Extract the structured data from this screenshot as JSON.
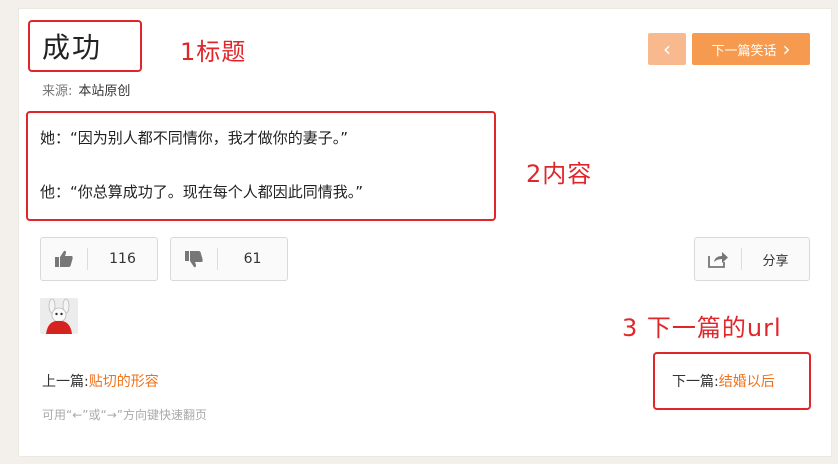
{
  "article": {
    "title": "成功",
    "source_label": "来源:",
    "source_value": "本站原创",
    "lines": [
      "她：“因为别人都不同情你，我才做你的妻子。”",
      "他：“你总算成功了。现在每个人都因此同情我。”"
    ]
  },
  "nav": {
    "prev_symbol": "‹",
    "next_label": "下一篇笑话",
    "next_symbol": "›"
  },
  "votes": {
    "up_count": "116",
    "down_count": "61",
    "share_label": "分享"
  },
  "footer": {
    "prev_label": "上一篇:",
    "prev_title": "贴切的形容",
    "next_label": "下一篇:",
    "next_title": "结婚以后",
    "hint": "可用“←”或“→”方向键快速翻页"
  },
  "annotations": {
    "a1": "1标题",
    "a2": "2内容",
    "a3": "3 下一篇的url"
  },
  "colors": {
    "accent_orange": "#f59a4f",
    "accent_orange_light": "#f9b98e",
    "link_orange": "#f0711b",
    "annotation_red": "#e0262b"
  }
}
